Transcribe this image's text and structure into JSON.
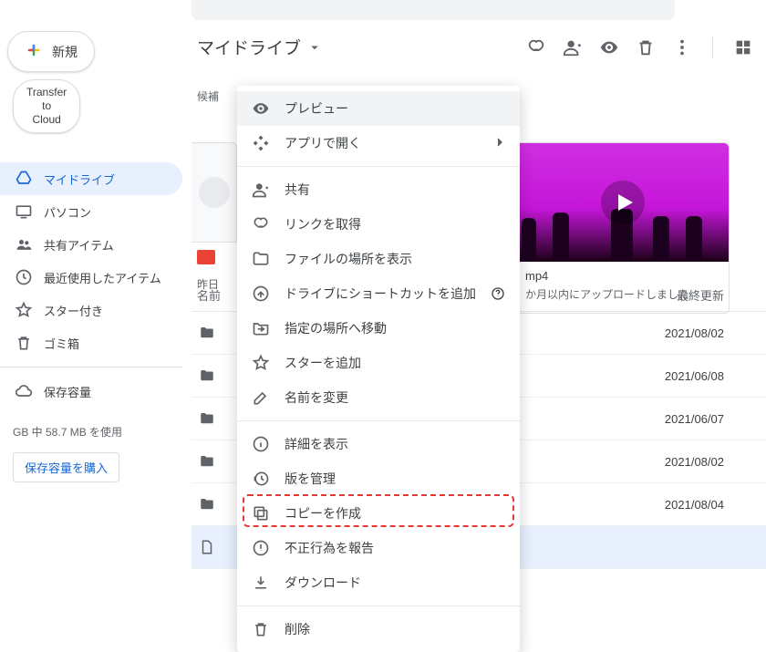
{
  "sidebar": {
    "new_label": "新規",
    "transfer_line1": "Transfer",
    "transfer_line2": "to",
    "transfer_line3": "Cloud",
    "items": [
      {
        "label": "マイドライブ"
      },
      {
        "label": "パソコン"
      },
      {
        "label": "共有アイテム"
      },
      {
        "label": "最近使用したアイテム"
      },
      {
        "label": "スター付き"
      },
      {
        "label": "ゴミ箱"
      }
    ],
    "storage_label": "保存容量",
    "storage_used": "GB 中 58.7 MB を使用",
    "buy_storage": "保存容量を購入"
  },
  "main": {
    "title": "マイドライブ",
    "suggest_label": "候補",
    "card_left_date": "昨日",
    "video": {
      "ext": "mp4",
      "uploaded": "か月以内にアップロードしました"
    },
    "table": {
      "head_name": "名前",
      "head_modified": "最終更新",
      "rows": [
        {
          "date": "2021/08/02",
          "type": "folder"
        },
        {
          "date": "2021/06/08",
          "type": "folder"
        },
        {
          "date": "2021/06/07",
          "type": "folder"
        },
        {
          "date": "2021/08/02",
          "type": "folder"
        },
        {
          "date": "2021/08/04",
          "type": "folder"
        },
        {
          "date": "",
          "type": "file"
        }
      ]
    }
  },
  "menu": {
    "preview": "プレビュー",
    "open_with": "アプリで開く",
    "share": "共有",
    "get_link": "リンクを取得",
    "show_location": "ファイルの場所を表示",
    "add_shortcut": "ドライブにショートカットを追加",
    "move_to": "指定の場所へ移動",
    "add_star": "スターを追加",
    "rename": "名前を変更",
    "view_details": "詳細を表示",
    "manage_versions": "版を管理",
    "make_copy": "コピーを作成",
    "report_abuse": "不正行為を報告",
    "download": "ダウンロード",
    "remove": "削除"
  }
}
